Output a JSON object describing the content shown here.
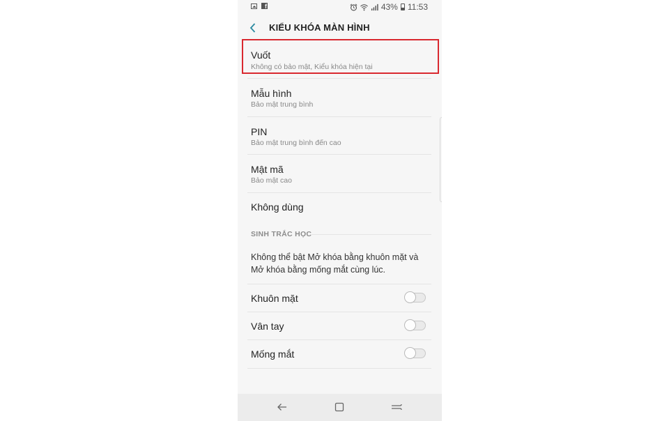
{
  "status_bar": {
    "left_icons": [
      "gallery-icon",
      "facebook-icon"
    ],
    "right_icons": [
      "alarm-icon",
      "wifi-icon",
      "signal-icon"
    ],
    "battery": "43%",
    "time": "11:53"
  },
  "app_bar": {
    "back_icon": "chevron-left-icon",
    "title": "KIỂU KHÓA MÀN HÌNH"
  },
  "lock_options": [
    {
      "title": "Vuốt",
      "subtitle": "Không có bảo mật, Kiểu khóa hiện tại",
      "selected": true
    },
    {
      "title": "Mẫu hình",
      "subtitle": "Bảo mật trung bình"
    },
    {
      "title": "PIN",
      "subtitle": "Bảo mật trung bình đến cao"
    },
    {
      "title": "Mật mã",
      "subtitle": "Bảo mật cao"
    },
    {
      "title": "Không dùng",
      "subtitle": ""
    }
  ],
  "biometrics": {
    "header": "SINH TRẮC HỌC",
    "description": "Không thể bật Mở khóa bằng khuôn mặt và Mở khóa bằng mống mắt cùng lúc.",
    "toggles": [
      {
        "label": "Khuôn mặt",
        "on": false
      },
      {
        "label": "Vân tay",
        "on": false
      },
      {
        "label": "Mống mắt",
        "on": false
      }
    ]
  },
  "nav_bar": {
    "buttons": [
      "back-nav-icon",
      "home-nav-icon",
      "recents-nav-icon"
    ]
  },
  "colors": {
    "background": "#f6f6f6",
    "highlight_border": "#d9282f",
    "back_arrow": "#2b8aa0"
  }
}
